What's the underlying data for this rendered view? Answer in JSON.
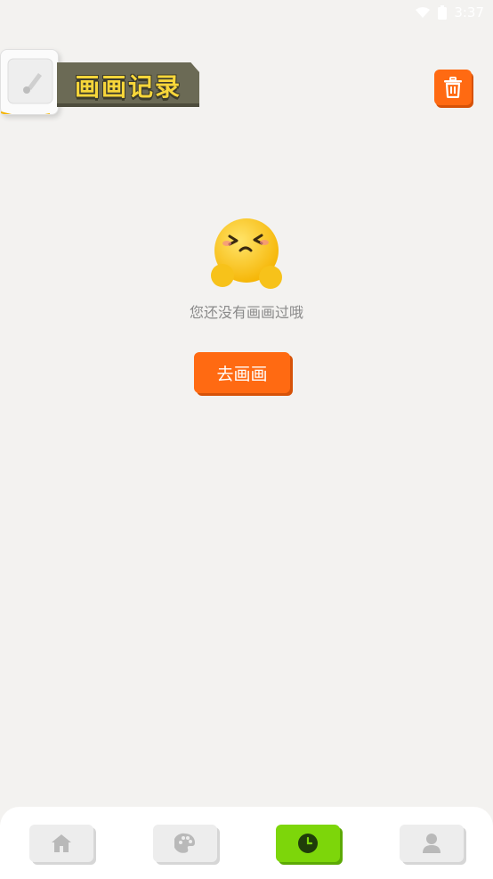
{
  "status_bar": {
    "time": "3:37"
  },
  "header": {
    "title": "画画记录"
  },
  "empty_state": {
    "message": "您还没有画画过哦",
    "action_label": "去画画"
  },
  "bottom_nav": {
    "items": [
      {
        "icon": "home-icon",
        "active": false
      },
      {
        "icon": "palette-icon",
        "active": false
      },
      {
        "icon": "clock-icon",
        "active": true
      },
      {
        "icon": "person-icon",
        "active": false
      }
    ]
  },
  "colors": {
    "accent": "#ff6a12",
    "active_tab": "#7dd60a",
    "title_text": "#f7d63a",
    "title_ribbon": "#6b6a55",
    "background": "#f3f2f0"
  }
}
